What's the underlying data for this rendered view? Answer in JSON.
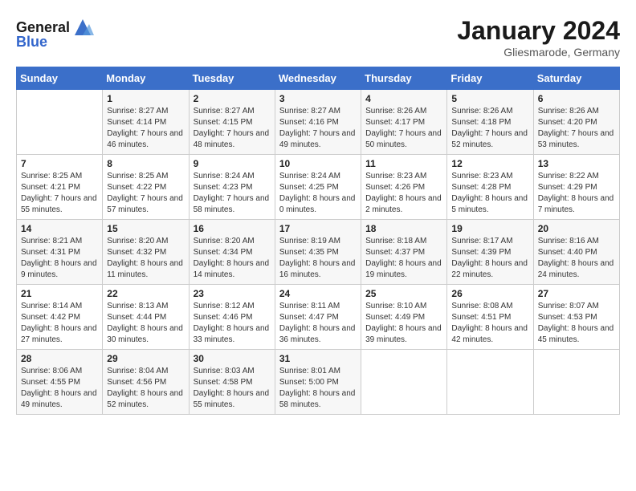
{
  "logo": {
    "general": "General",
    "blue": "Blue"
  },
  "title": {
    "month_year": "January 2024",
    "location": "Gliesmarode, Germany"
  },
  "headers": [
    "Sunday",
    "Monday",
    "Tuesday",
    "Wednesday",
    "Thursday",
    "Friday",
    "Saturday"
  ],
  "weeks": [
    [
      {
        "day": "",
        "sunrise": "",
        "sunset": "",
        "daylight": ""
      },
      {
        "day": "1",
        "sunrise": "Sunrise: 8:27 AM",
        "sunset": "Sunset: 4:14 PM",
        "daylight": "Daylight: 7 hours and 46 minutes."
      },
      {
        "day": "2",
        "sunrise": "Sunrise: 8:27 AM",
        "sunset": "Sunset: 4:15 PM",
        "daylight": "Daylight: 7 hours and 48 minutes."
      },
      {
        "day": "3",
        "sunrise": "Sunrise: 8:27 AM",
        "sunset": "Sunset: 4:16 PM",
        "daylight": "Daylight: 7 hours and 49 minutes."
      },
      {
        "day": "4",
        "sunrise": "Sunrise: 8:26 AM",
        "sunset": "Sunset: 4:17 PM",
        "daylight": "Daylight: 7 hours and 50 minutes."
      },
      {
        "day": "5",
        "sunrise": "Sunrise: 8:26 AM",
        "sunset": "Sunset: 4:18 PM",
        "daylight": "Daylight: 7 hours and 52 minutes."
      },
      {
        "day": "6",
        "sunrise": "Sunrise: 8:26 AM",
        "sunset": "Sunset: 4:20 PM",
        "daylight": "Daylight: 7 hours and 53 minutes."
      }
    ],
    [
      {
        "day": "7",
        "sunrise": "Sunrise: 8:25 AM",
        "sunset": "Sunset: 4:21 PM",
        "daylight": "Daylight: 7 hours and 55 minutes."
      },
      {
        "day": "8",
        "sunrise": "Sunrise: 8:25 AM",
        "sunset": "Sunset: 4:22 PM",
        "daylight": "Daylight: 7 hours and 57 minutes."
      },
      {
        "day": "9",
        "sunrise": "Sunrise: 8:24 AM",
        "sunset": "Sunset: 4:23 PM",
        "daylight": "Daylight: 7 hours and 58 minutes."
      },
      {
        "day": "10",
        "sunrise": "Sunrise: 8:24 AM",
        "sunset": "Sunset: 4:25 PM",
        "daylight": "Daylight: 8 hours and 0 minutes."
      },
      {
        "day": "11",
        "sunrise": "Sunrise: 8:23 AM",
        "sunset": "Sunset: 4:26 PM",
        "daylight": "Daylight: 8 hours and 2 minutes."
      },
      {
        "day": "12",
        "sunrise": "Sunrise: 8:23 AM",
        "sunset": "Sunset: 4:28 PM",
        "daylight": "Daylight: 8 hours and 5 minutes."
      },
      {
        "day": "13",
        "sunrise": "Sunrise: 8:22 AM",
        "sunset": "Sunset: 4:29 PM",
        "daylight": "Daylight: 8 hours and 7 minutes."
      }
    ],
    [
      {
        "day": "14",
        "sunrise": "Sunrise: 8:21 AM",
        "sunset": "Sunset: 4:31 PM",
        "daylight": "Daylight: 8 hours and 9 minutes."
      },
      {
        "day": "15",
        "sunrise": "Sunrise: 8:20 AM",
        "sunset": "Sunset: 4:32 PM",
        "daylight": "Daylight: 8 hours and 11 minutes."
      },
      {
        "day": "16",
        "sunrise": "Sunrise: 8:20 AM",
        "sunset": "Sunset: 4:34 PM",
        "daylight": "Daylight: 8 hours and 14 minutes."
      },
      {
        "day": "17",
        "sunrise": "Sunrise: 8:19 AM",
        "sunset": "Sunset: 4:35 PM",
        "daylight": "Daylight: 8 hours and 16 minutes."
      },
      {
        "day": "18",
        "sunrise": "Sunrise: 8:18 AM",
        "sunset": "Sunset: 4:37 PM",
        "daylight": "Daylight: 8 hours and 19 minutes."
      },
      {
        "day": "19",
        "sunrise": "Sunrise: 8:17 AM",
        "sunset": "Sunset: 4:39 PM",
        "daylight": "Daylight: 8 hours and 22 minutes."
      },
      {
        "day": "20",
        "sunrise": "Sunrise: 8:16 AM",
        "sunset": "Sunset: 4:40 PM",
        "daylight": "Daylight: 8 hours and 24 minutes."
      }
    ],
    [
      {
        "day": "21",
        "sunrise": "Sunrise: 8:14 AM",
        "sunset": "Sunset: 4:42 PM",
        "daylight": "Daylight: 8 hours and 27 minutes."
      },
      {
        "day": "22",
        "sunrise": "Sunrise: 8:13 AM",
        "sunset": "Sunset: 4:44 PM",
        "daylight": "Daylight: 8 hours and 30 minutes."
      },
      {
        "day": "23",
        "sunrise": "Sunrise: 8:12 AM",
        "sunset": "Sunset: 4:46 PM",
        "daylight": "Daylight: 8 hours and 33 minutes."
      },
      {
        "day": "24",
        "sunrise": "Sunrise: 8:11 AM",
        "sunset": "Sunset: 4:47 PM",
        "daylight": "Daylight: 8 hours and 36 minutes."
      },
      {
        "day": "25",
        "sunrise": "Sunrise: 8:10 AM",
        "sunset": "Sunset: 4:49 PM",
        "daylight": "Daylight: 8 hours and 39 minutes."
      },
      {
        "day": "26",
        "sunrise": "Sunrise: 8:08 AM",
        "sunset": "Sunset: 4:51 PM",
        "daylight": "Daylight: 8 hours and 42 minutes."
      },
      {
        "day": "27",
        "sunrise": "Sunrise: 8:07 AM",
        "sunset": "Sunset: 4:53 PM",
        "daylight": "Daylight: 8 hours and 45 minutes."
      }
    ],
    [
      {
        "day": "28",
        "sunrise": "Sunrise: 8:06 AM",
        "sunset": "Sunset: 4:55 PM",
        "daylight": "Daylight: 8 hours and 49 minutes."
      },
      {
        "day": "29",
        "sunrise": "Sunrise: 8:04 AM",
        "sunset": "Sunset: 4:56 PM",
        "daylight": "Daylight: 8 hours and 52 minutes."
      },
      {
        "day": "30",
        "sunrise": "Sunrise: 8:03 AM",
        "sunset": "Sunset: 4:58 PM",
        "daylight": "Daylight: 8 hours and 55 minutes."
      },
      {
        "day": "31",
        "sunrise": "Sunrise: 8:01 AM",
        "sunset": "Sunset: 5:00 PM",
        "daylight": "Daylight: 8 hours and 58 minutes."
      },
      {
        "day": "",
        "sunrise": "",
        "sunset": "",
        "daylight": ""
      },
      {
        "day": "",
        "sunrise": "",
        "sunset": "",
        "daylight": ""
      },
      {
        "day": "",
        "sunrise": "",
        "sunset": "",
        "daylight": ""
      }
    ]
  ]
}
